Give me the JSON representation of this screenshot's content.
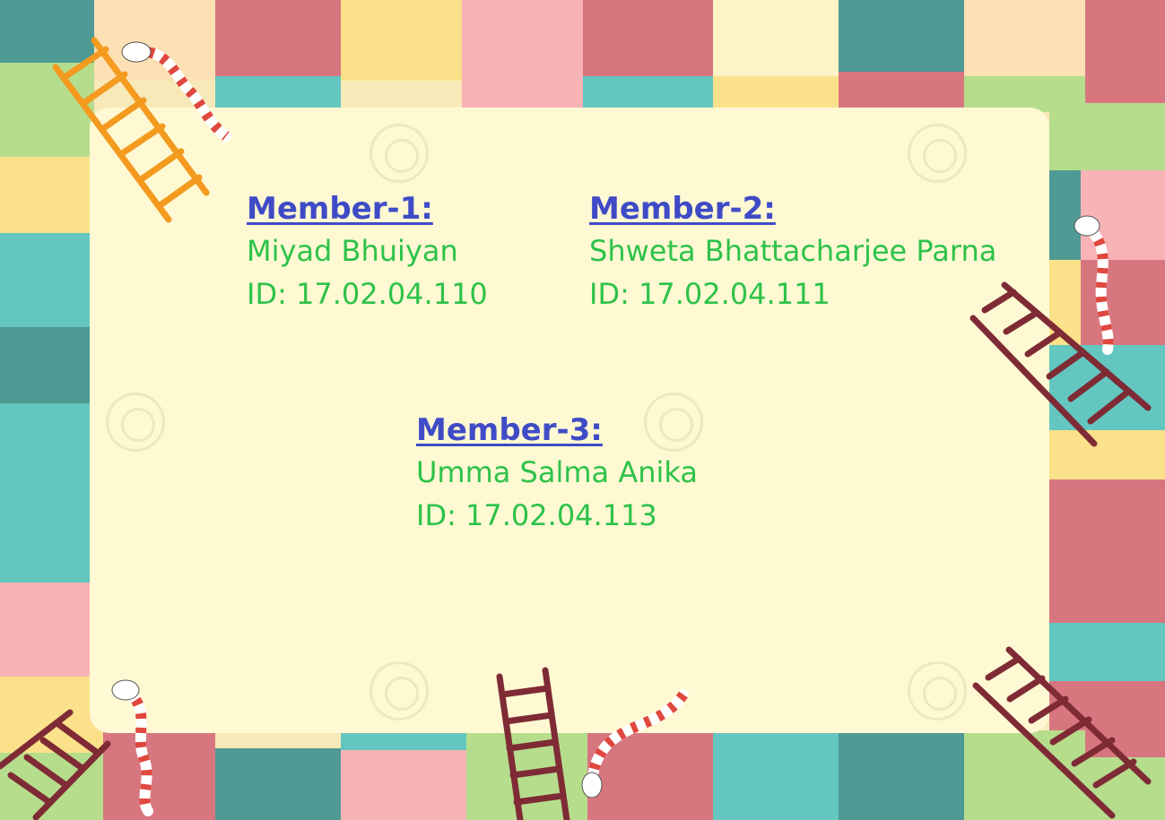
{
  "colors": {
    "panel": "#fef9d3",
    "title": "#3f4bc6",
    "text": "#2ec24a",
    "tile_teal": "#4f9a94",
    "tile_aqua": "#63c7c0",
    "tile_rose": "#d87680",
    "tile_pink": "#f7b3b5",
    "tile_yellow": "#fbe18a",
    "tile_peach": "#fde1b4",
    "tile_green": "#b6dd8c",
    "ladder_orange": "#f39a1f",
    "ladder_brown": "#7f2b35"
  },
  "members": [
    {
      "title": "Member-1:",
      "name": "Miyad Bhuiyan",
      "id": "ID: 17.02.04.110"
    },
    {
      "title": "Member-2:",
      "name": "Shweta Bhattacharjee Parna",
      "id": "ID: 17.02.04.111"
    },
    {
      "title": "Member-3:",
      "name": "Umma Salma Anika",
      "id": "ID: 17.02.04.113"
    }
  ],
  "decorations": {
    "board_theme": "snakes-and-ladders",
    "icons": [
      "ladder-icon",
      "snake-icon"
    ]
  }
}
